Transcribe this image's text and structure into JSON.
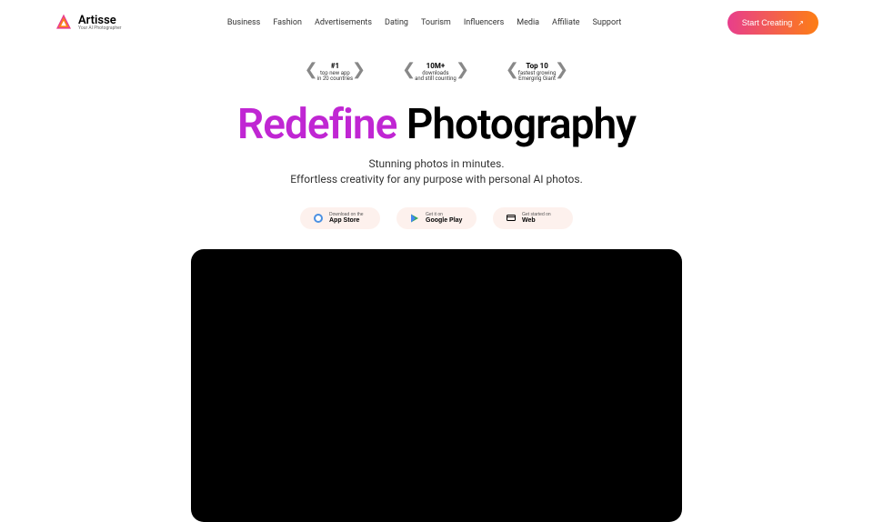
{
  "logo": {
    "name": "Artisse",
    "tagline": "Your AI Photographer"
  },
  "nav": {
    "items": [
      "Business",
      "Fashion",
      "Advertisements",
      "Dating",
      "Tourism",
      "Influencers",
      "Media",
      "Affiliate",
      "Support"
    ]
  },
  "cta": {
    "label": "Start Creating"
  },
  "badges": [
    {
      "title": "#1",
      "line1": "top new app",
      "line2": "in 20 countries"
    },
    {
      "title": "10M+",
      "line1": "downloads",
      "line2": "and still counting"
    },
    {
      "title": "Top 10",
      "line1": "fastest growing",
      "line2": "Emerging Giant"
    }
  ],
  "hero": {
    "accent": "Redefine",
    "main": "Photography",
    "sub1": "Stunning photos in minutes.",
    "sub2": "Effortless creativity for any purpose with personal AI photos."
  },
  "stores": [
    {
      "top": "Download on the",
      "bottom": "App Store",
      "icon": "apple"
    },
    {
      "top": "Get it on",
      "bottom": "Google Play",
      "icon": "play"
    },
    {
      "top": "Get started on",
      "bottom": "Web",
      "icon": "web"
    }
  ]
}
